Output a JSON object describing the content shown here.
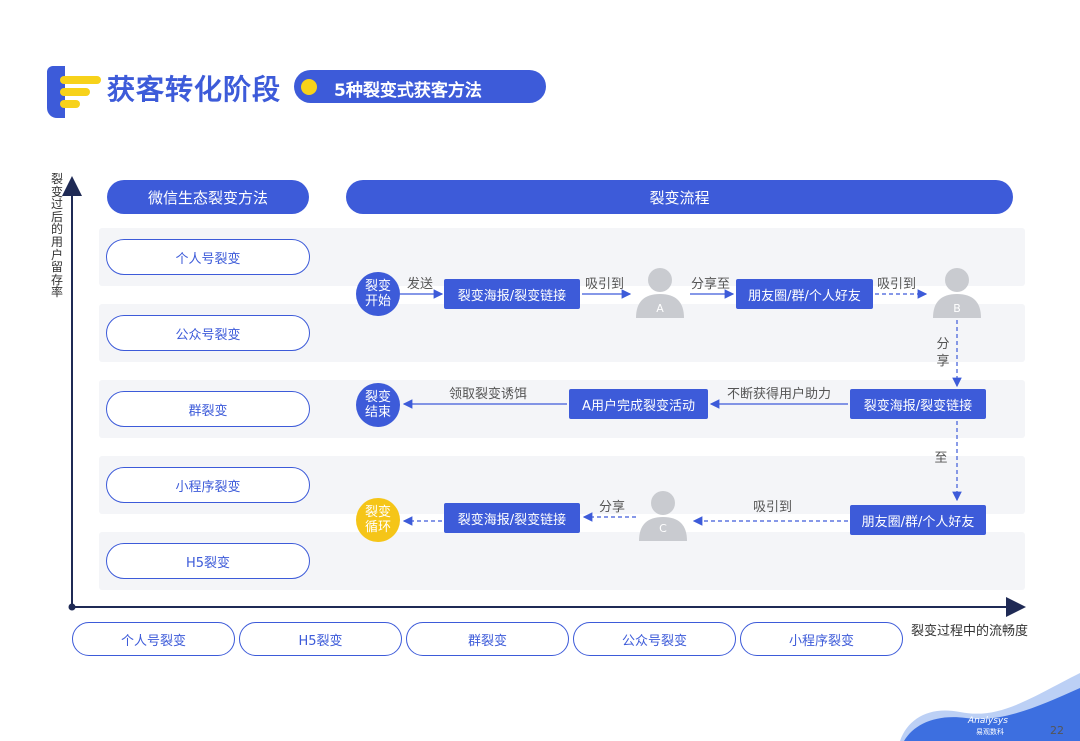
{
  "header": {
    "title": "获客转化阶段",
    "subtitle": "5种裂变式获客方法"
  },
  "axes": {
    "y_label": [
      "裂",
      "变",
      "过",
      "后",
      "的",
      "用",
      "户",
      "留",
      "存",
      "率"
    ],
    "x_label": "裂变过程中的流畅度"
  },
  "columns": {
    "left_header": "微信生态裂变方法",
    "right_header": "裂变流程"
  },
  "methods": [
    "个人号裂变",
    "公众号裂变",
    "群裂变",
    "小程序裂变",
    "H5裂变"
  ],
  "flow": {
    "start_node": [
      "裂变",
      "开始"
    ],
    "end_node": [
      "裂变",
      "结束"
    ],
    "loop_node": [
      "裂变",
      "循环"
    ],
    "row1": {
      "label_send": "发送",
      "box1": "裂变海报/裂变链接",
      "label_attract1": "吸引到",
      "avatar_a": "A",
      "label_share_to": "分享至",
      "box2": "朋友圈/群/个人好友",
      "label_attract2": "吸引到",
      "avatar_b": "B"
    },
    "vertical1": [
      "分",
      "享"
    ],
    "row2": {
      "box3": "裂变海报/裂变链接",
      "label_help": "不断获得用户助力",
      "box4": "A用户完成裂变活动",
      "label_reward": "领取裂变诱饵"
    },
    "vertical2": "至",
    "row3": {
      "box5": "朋友圈/群/个人好友",
      "label_attract3": "吸引到",
      "avatar_c": "C",
      "label_share": "分享",
      "box6": "裂变海报/裂变链接"
    }
  },
  "bottom_pills": [
    "个人号裂变",
    "H5裂变",
    "群裂变",
    "公众号裂变",
    "小程序裂变"
  ],
  "footer": {
    "brand_en": "Analysys",
    "brand_cn": "易观数科",
    "page_number": "22"
  },
  "colors": {
    "primary": "#3d5bd9",
    "accent_yellow": "#f5c518",
    "band": "#f4f5f8",
    "avatar_gray": "#c9cbd0"
  }
}
